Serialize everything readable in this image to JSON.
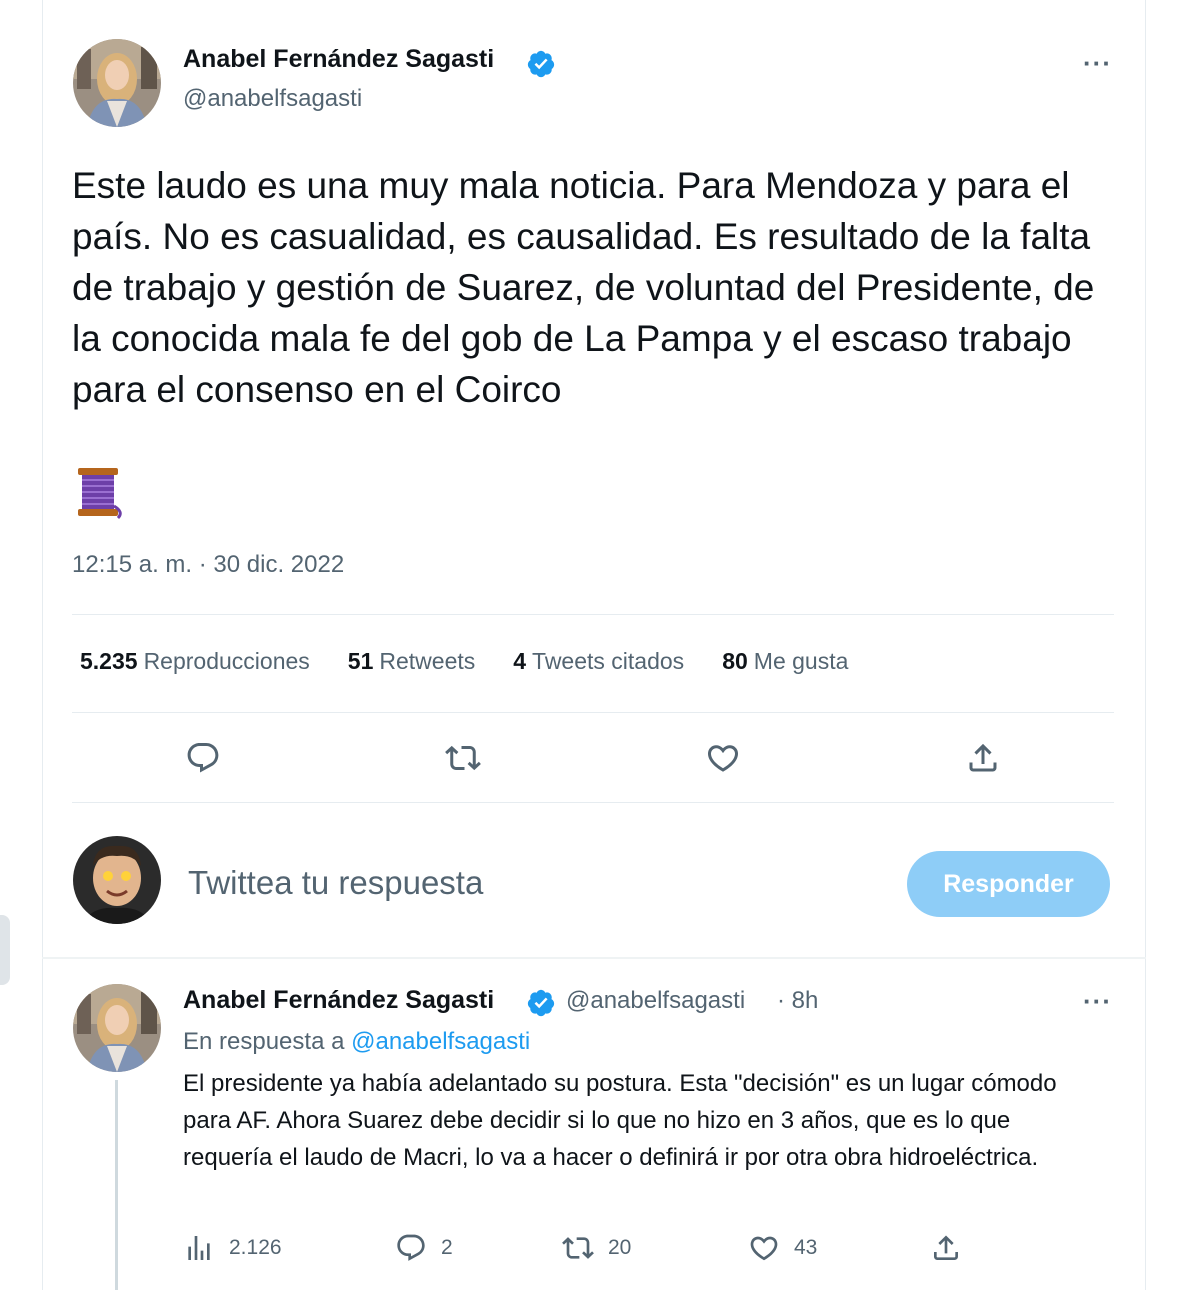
{
  "main_tweet": {
    "author_name": "Anabel Fernández Sagasti",
    "author_handle": "@anabelfsagasti",
    "more_label": "···",
    "text": "Este laudo es una muy mala noticia. Para Mendoza y para el país. No es casualidad, es causalidad. Es resultado de la falta de trabajo y gestión de Suarez, de voluntad del Presidente, de la conocida mala fe del gob de La Pampa y el escaso trabajo para el consenso en el Coirco",
    "emoji": "thread-spool",
    "timestamp": "12:15 a. m. · 30 dic. 2022",
    "stats": [
      {
        "num": "5.235",
        "label": "Reproducciones"
      },
      {
        "num": "51",
        "label": "Retweets"
      },
      {
        "num": "4",
        "label": "Tweets citados"
      },
      {
        "num": "80",
        "label": "Me gusta"
      }
    ]
  },
  "compose": {
    "placeholder": "Twittea tu respuesta",
    "button_label": "Responder"
  },
  "reply_tweet": {
    "author_name": "Anabel Fernández Sagasti",
    "author_handle": "@anabelfsagasti",
    "time": "· 8h",
    "more_label": "···",
    "in_reply_prefix": "En respuesta a",
    "in_reply_handle": "@anabelfsagasti",
    "text": "El presidente ya había adelantado su postura. Esta \"decisión\" es un lugar cómodo para AF. Ahora Suarez debe decidir si lo que no hizo en 3 años, que es lo que requería el laudo de Macri, lo va a hacer o definirá ir por otra obra hidroeléctrica.",
    "actions": {
      "views": "2.126",
      "replies": "2",
      "retweets": "20",
      "likes": "43"
    }
  },
  "colors": {
    "accent": "#1d9bf0",
    "button_disabled": "#8ecdf7",
    "secondary_text": "#536471"
  }
}
